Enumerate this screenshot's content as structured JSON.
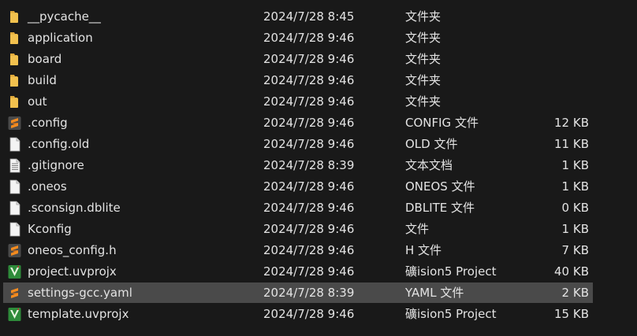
{
  "files": [
    {
      "icon": "folder-icon",
      "name": "__pycache__",
      "date": "2024/7/28 8:45",
      "type": "文件夹",
      "size": ""
    },
    {
      "icon": "folder-icon",
      "name": "application",
      "date": "2024/7/28 9:46",
      "type": "文件夹",
      "size": ""
    },
    {
      "icon": "folder-icon",
      "name": "board",
      "date": "2024/7/28 9:46",
      "type": "文件夹",
      "size": ""
    },
    {
      "icon": "folder-icon",
      "name": "build",
      "date": "2024/7/28 9:46",
      "type": "文件夹",
      "size": ""
    },
    {
      "icon": "folder-icon",
      "name": "out",
      "date": "2024/7/28 9:46",
      "type": "文件夹",
      "size": ""
    },
    {
      "icon": "sublime-file-icon",
      "name": ".config",
      "date": "2024/7/28 9:46",
      "type": "CONFIG 文件",
      "size": "12 KB"
    },
    {
      "icon": "blank-file-icon",
      "name": ".config.old",
      "date": "2024/7/28 9:46",
      "type": "OLD 文件",
      "size": "11 KB"
    },
    {
      "icon": "text-file-icon",
      "name": ".gitignore",
      "date": "2024/7/28 8:39",
      "type": "文本文档",
      "size": "1 KB"
    },
    {
      "icon": "blank-file-icon",
      "name": ".oneos",
      "date": "2024/7/28 9:46",
      "type": "ONEOS 文件",
      "size": "1 KB"
    },
    {
      "icon": "blank-file-icon",
      "name": ".sconsign.dblite",
      "date": "2024/7/28 9:46",
      "type": "DBLITE 文件",
      "size": "0 KB"
    },
    {
      "icon": "blank-file-icon",
      "name": "Kconfig",
      "date": "2024/7/28 9:46",
      "type": "文件",
      "size": "1 KB"
    },
    {
      "icon": "sublime-file-icon",
      "name": "oneos_config.h",
      "date": "2024/7/28 9:46",
      "type": "H 文件",
      "size": "7 KB"
    },
    {
      "icon": "keil-project-icon",
      "name": "project.uvprojx",
      "date": "2024/7/28 9:46",
      "type": "礦ision5 Project",
      "size": "40 KB"
    },
    {
      "icon": "sublime-file-icon",
      "name": "settings-gcc.yaml",
      "date": "2024/7/28 8:39",
      "type": "YAML 文件",
      "size": "2 KB",
      "selected": true
    },
    {
      "icon": "keil-project-icon",
      "name": "template.uvprojx",
      "date": "2024/7/28 9:46",
      "type": "礦ision5 Project",
      "size": "15 KB"
    }
  ],
  "colors": {
    "background": "#191919",
    "text": "#e3e3e3",
    "selection": "#4a4a4a",
    "folder": "#f2c14e",
    "sublime_orange": "#f58c1f",
    "keil_green": "#2e8b3a"
  }
}
